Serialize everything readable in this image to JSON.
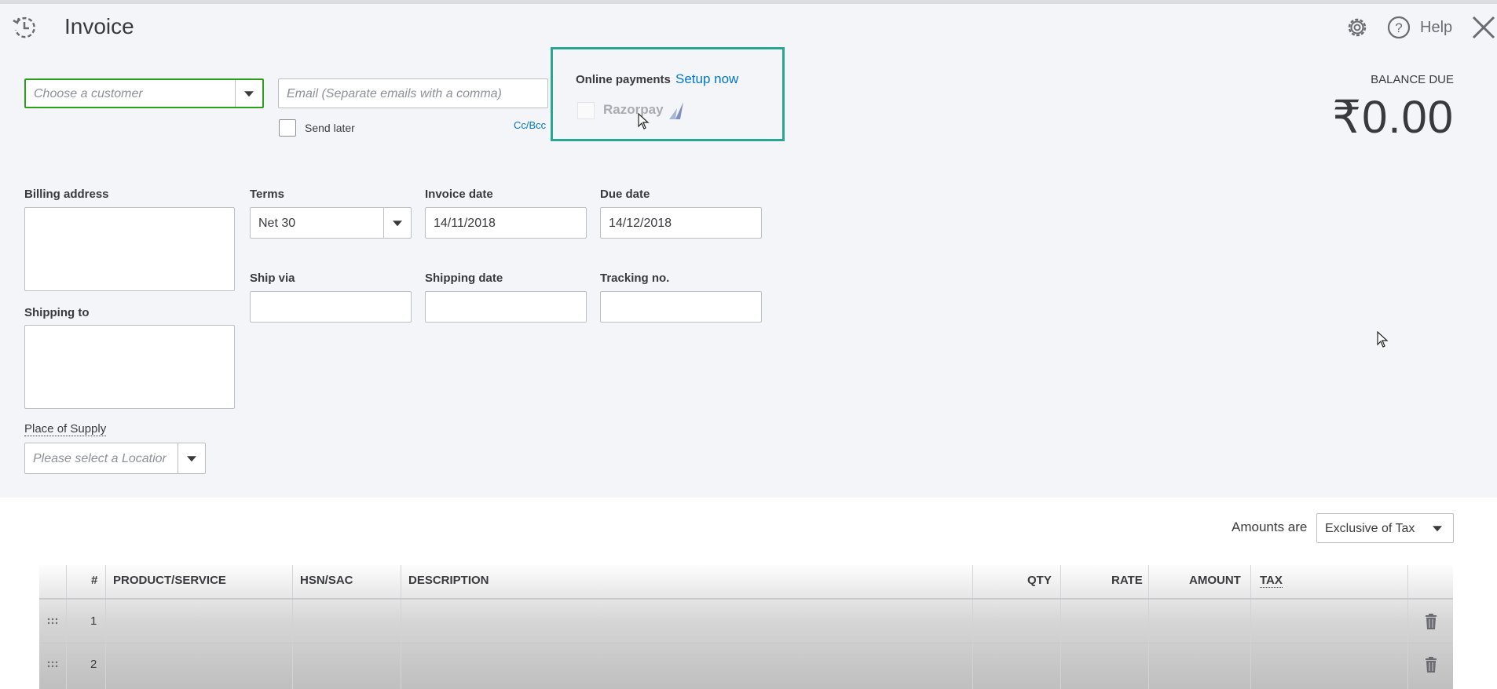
{
  "header": {
    "title": "Invoice",
    "help_label": "Help"
  },
  "customer": {
    "placeholder": "Choose a customer"
  },
  "email": {
    "placeholder": "Email (Separate emails with a comma)",
    "send_later_label": "Send later",
    "cc_bcc_label": "Cc/Bcc"
  },
  "online_payments": {
    "label": "Online payments",
    "setup_link": "Setup now",
    "razorpay_label": "Razorpay"
  },
  "balance": {
    "label": "BALANCE DUE",
    "amount": "₹0.00"
  },
  "form": {
    "billing_address_label": "Billing address",
    "shipping_to_label": "Shipping to",
    "terms_label": "Terms",
    "terms_value": "Net 30",
    "invoice_date_label": "Invoice date",
    "invoice_date_value": "14/11/2018",
    "due_date_label": "Due date",
    "due_date_value": "14/12/2018",
    "ship_via_label": "Ship via",
    "shipping_date_label": "Shipping date",
    "tracking_label": "Tracking no.",
    "place_of_supply_label": "Place of Supply",
    "place_of_supply_placeholder": "Please select a Location"
  },
  "amounts": {
    "label": "Amounts are",
    "value": "Exclusive of Tax"
  },
  "table": {
    "columns": [
      "#",
      "PRODUCT/SERVICE",
      "HSN/SAC",
      "DESCRIPTION",
      "QTY",
      "RATE",
      "AMOUNT",
      "TAX"
    ],
    "rows": [
      {
        "num": "1"
      },
      {
        "num": "2"
      }
    ]
  }
}
